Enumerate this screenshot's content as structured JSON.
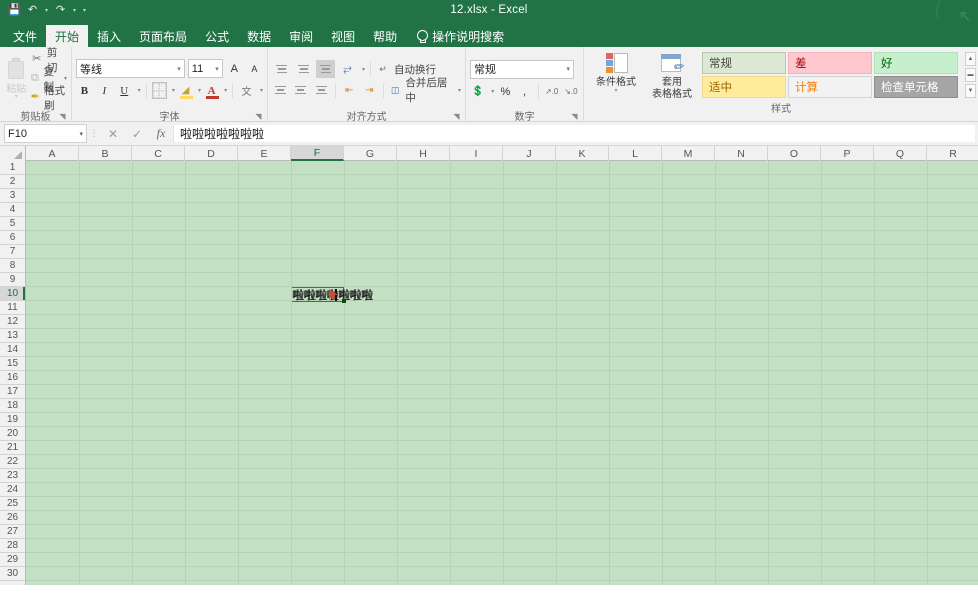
{
  "window": {
    "title": "12.xlsx  -  Excel",
    "quick_access": [
      {
        "name": "save",
        "glyph": "Ὃe"
      },
      {
        "name": "undo",
        "glyph": "↶"
      },
      {
        "name": "redo",
        "glyph": "↷"
      },
      {
        "name": "customize",
        "glyph": "▾"
      }
    ]
  },
  "tabs": [
    {
      "label": "文件",
      "active": false
    },
    {
      "label": "开始",
      "active": true
    },
    {
      "label": "插入",
      "active": false
    },
    {
      "label": "页面布局",
      "active": false
    },
    {
      "label": "公式",
      "active": false
    },
    {
      "label": "数据",
      "active": false
    },
    {
      "label": "审阅",
      "active": false
    },
    {
      "label": "视图",
      "active": false
    },
    {
      "label": "帮助",
      "active": false
    }
  ],
  "tell_me": "操作说明搜索",
  "ribbon": {
    "clipboard": {
      "label": "剪贴板",
      "paste": "粘贴",
      "items": [
        {
          "label": "剪切",
          "icon": "scissors-icon",
          "glyph": "✂"
        },
        {
          "label": "复制",
          "icon": "copy-icon",
          "glyph": "⧉"
        },
        {
          "label": "格式刷",
          "icon": "format-painter-icon",
          "glyph": "✒"
        }
      ]
    },
    "font": {
      "label": "字体",
      "font_name": "等线",
      "font_size": "11",
      "grow_font": "A",
      "shrink_font": "A",
      "bold": "B",
      "italic": "I",
      "underline": "U",
      "fill_color": "◆",
      "font_color": "A",
      "phonetic": "文"
    },
    "alignment": {
      "label": "对齐方式",
      "wrap_text": "自动换行",
      "merge_center": "合并后居中",
      "orientation_icon": "orientation-icon"
    },
    "number": {
      "label": "数字",
      "format": "常规",
      "percent": "%",
      "comma": ",",
      "accounting": "国"
    },
    "styles": {
      "label": "样式",
      "conditional_formatting": "条件格式",
      "format_as_table_line1": "套用",
      "format_as_table_line2": "表格格式",
      "gallery": [
        {
          "label": "常规",
          "bg": "#dbe8d4",
          "fg": "#444444",
          "border": "#b7c9ae"
        },
        {
          "label": "差",
          "bg": "#ffc7ce",
          "fg": "#9c0006",
          "border": "#f0b4bc"
        },
        {
          "label": "好",
          "bg": "#c6efce",
          "fg": "#006100",
          "border": "#b0dfb8"
        },
        {
          "label": "适中",
          "bg": "#ffeb9c",
          "fg": "#9c6500",
          "border": "#efd98b"
        },
        {
          "label": "计算",
          "bg": "#f2f2f2",
          "fg": "#fa7d00",
          "border": "#d4d4d4"
        },
        {
          "label": "检查单元格",
          "bg": "#a5a5a5",
          "fg": "#ffffff",
          "border": "#8f8f8f"
        }
      ],
      "scroll_up": "▲",
      "scroll_more": "▬",
      "scroll_down": "▼"
    }
  },
  "formula_bar": {
    "name_box": "F10",
    "cancel_icon": "✕",
    "enter_icon": "✓",
    "function_icon": "fx",
    "value": "啦啦啦啦啦啦啦"
  },
  "grid": {
    "columns": [
      "A",
      "B",
      "C",
      "D",
      "E",
      "F",
      "G",
      "H",
      "I",
      "J",
      "K",
      "L",
      "M",
      "N",
      "O",
      "P",
      "Q",
      "R"
    ],
    "selected_column": "F",
    "rows": [
      1,
      2,
      3,
      4,
      5,
      6,
      7,
      8,
      9,
      10,
      11,
      12,
      13,
      14,
      15,
      16,
      17,
      18,
      19,
      20,
      21,
      22,
      23,
      24,
      25,
      26,
      27,
      28,
      29,
      30
    ],
    "selected_row": 10,
    "active_cell": "F10",
    "cell_text": "啦啦啦啦啦啦啦",
    "editing": true,
    "background_color": "#c4e0c4",
    "gridline_color": "#b4d3b4"
  },
  "theme": {
    "accent": "#217346",
    "ribbon_bg": "#f1f1f1",
    "header_bg": "#f1f1f1"
  }
}
